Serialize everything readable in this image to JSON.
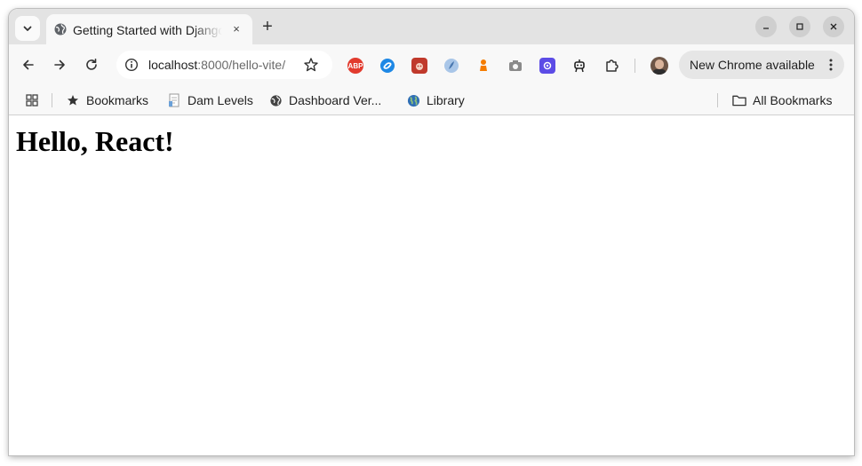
{
  "tab": {
    "title": "Getting Started with Django and Vite",
    "favicon": "globe-icon",
    "close": "×",
    "new_tab": "+"
  },
  "omnibox": {
    "host": "localhost",
    "path": ":8000/hello-vite/"
  },
  "extensions": [
    {
      "name": "adblock-plus-icon",
      "label": "ABP",
      "color": "#e23b2e"
    },
    {
      "name": "swirl-extension-icon",
      "label": "",
      "color": "#1e88e5"
    },
    {
      "name": "reddit-extension-icon",
      "label": "",
      "color": "#c0392b"
    },
    {
      "name": "feather-extension-icon",
      "label": "",
      "color": "#7aa7d8"
    },
    {
      "name": "chess-pawn-extension-icon",
      "label": "",
      "color": "#f57c00"
    },
    {
      "name": "camera-extension-icon",
      "label": "",
      "color": "#8a8a8a"
    },
    {
      "name": "gear-extension-icon",
      "label": "",
      "color": "#5c4ce6"
    },
    {
      "name": "robot-extension-icon",
      "label": "",
      "color": "#222222"
    }
  ],
  "update_chip": {
    "label": "New Chrome available"
  },
  "bookmarks": {
    "items": [
      {
        "label": "Bookmarks",
        "icon": "star-icon"
      },
      {
        "label": "Dam Levels",
        "icon": "document-icon"
      },
      {
        "label": "Dashboard Ver...",
        "icon": "globe-icon"
      },
      {
        "label": "Library",
        "icon": "earth-icon"
      }
    ],
    "all_bookmarks": "All Bookmarks"
  },
  "page": {
    "heading": "Hello, React!"
  },
  "colors": {
    "tabstrip": "#e3e3e3",
    "toolbar": "#f8f8f8",
    "omnibox": "#ffffff",
    "chip": "#e6e6e6"
  }
}
